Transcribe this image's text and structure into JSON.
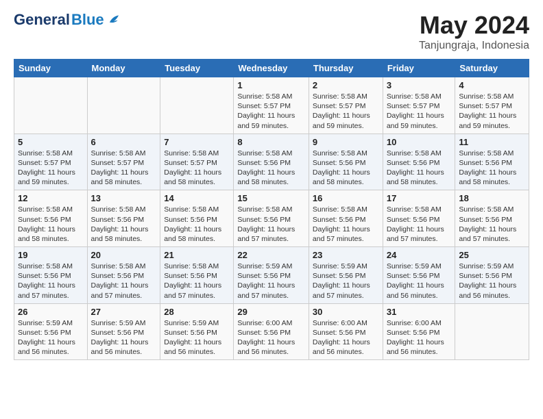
{
  "header": {
    "logo_general": "General",
    "logo_blue": "Blue",
    "month_title": "May 2024",
    "location": "Tanjungraja, Indonesia"
  },
  "weekdays": [
    "Sunday",
    "Monday",
    "Tuesday",
    "Wednesday",
    "Thursday",
    "Friday",
    "Saturday"
  ],
  "weeks": [
    [
      {
        "day": "",
        "info": ""
      },
      {
        "day": "",
        "info": ""
      },
      {
        "day": "",
        "info": ""
      },
      {
        "day": "1",
        "info": "Sunrise: 5:58 AM\nSunset: 5:57 PM\nDaylight: 11 hours\nand 59 minutes."
      },
      {
        "day": "2",
        "info": "Sunrise: 5:58 AM\nSunset: 5:57 PM\nDaylight: 11 hours\nand 59 minutes."
      },
      {
        "day": "3",
        "info": "Sunrise: 5:58 AM\nSunset: 5:57 PM\nDaylight: 11 hours\nand 59 minutes."
      },
      {
        "day": "4",
        "info": "Sunrise: 5:58 AM\nSunset: 5:57 PM\nDaylight: 11 hours\nand 59 minutes."
      }
    ],
    [
      {
        "day": "5",
        "info": "Sunrise: 5:58 AM\nSunset: 5:57 PM\nDaylight: 11 hours\nand 59 minutes."
      },
      {
        "day": "6",
        "info": "Sunrise: 5:58 AM\nSunset: 5:57 PM\nDaylight: 11 hours\nand 58 minutes."
      },
      {
        "day": "7",
        "info": "Sunrise: 5:58 AM\nSunset: 5:57 PM\nDaylight: 11 hours\nand 58 minutes."
      },
      {
        "day": "8",
        "info": "Sunrise: 5:58 AM\nSunset: 5:56 PM\nDaylight: 11 hours\nand 58 minutes."
      },
      {
        "day": "9",
        "info": "Sunrise: 5:58 AM\nSunset: 5:56 PM\nDaylight: 11 hours\nand 58 minutes."
      },
      {
        "day": "10",
        "info": "Sunrise: 5:58 AM\nSunset: 5:56 PM\nDaylight: 11 hours\nand 58 minutes."
      },
      {
        "day": "11",
        "info": "Sunrise: 5:58 AM\nSunset: 5:56 PM\nDaylight: 11 hours\nand 58 minutes."
      }
    ],
    [
      {
        "day": "12",
        "info": "Sunrise: 5:58 AM\nSunset: 5:56 PM\nDaylight: 11 hours\nand 58 minutes."
      },
      {
        "day": "13",
        "info": "Sunrise: 5:58 AM\nSunset: 5:56 PM\nDaylight: 11 hours\nand 58 minutes."
      },
      {
        "day": "14",
        "info": "Sunrise: 5:58 AM\nSunset: 5:56 PM\nDaylight: 11 hours\nand 58 minutes."
      },
      {
        "day": "15",
        "info": "Sunrise: 5:58 AM\nSunset: 5:56 PM\nDaylight: 11 hours\nand 57 minutes."
      },
      {
        "day": "16",
        "info": "Sunrise: 5:58 AM\nSunset: 5:56 PM\nDaylight: 11 hours\nand 57 minutes."
      },
      {
        "day": "17",
        "info": "Sunrise: 5:58 AM\nSunset: 5:56 PM\nDaylight: 11 hours\nand 57 minutes."
      },
      {
        "day": "18",
        "info": "Sunrise: 5:58 AM\nSunset: 5:56 PM\nDaylight: 11 hours\nand 57 minutes."
      }
    ],
    [
      {
        "day": "19",
        "info": "Sunrise: 5:58 AM\nSunset: 5:56 PM\nDaylight: 11 hours\nand 57 minutes."
      },
      {
        "day": "20",
        "info": "Sunrise: 5:58 AM\nSunset: 5:56 PM\nDaylight: 11 hours\nand 57 minutes."
      },
      {
        "day": "21",
        "info": "Sunrise: 5:58 AM\nSunset: 5:56 PM\nDaylight: 11 hours\nand 57 minutes."
      },
      {
        "day": "22",
        "info": "Sunrise: 5:59 AM\nSunset: 5:56 PM\nDaylight: 11 hours\nand 57 minutes."
      },
      {
        "day": "23",
        "info": "Sunrise: 5:59 AM\nSunset: 5:56 PM\nDaylight: 11 hours\nand 57 minutes."
      },
      {
        "day": "24",
        "info": "Sunrise: 5:59 AM\nSunset: 5:56 PM\nDaylight: 11 hours\nand 56 minutes."
      },
      {
        "day": "25",
        "info": "Sunrise: 5:59 AM\nSunset: 5:56 PM\nDaylight: 11 hours\nand 56 minutes."
      }
    ],
    [
      {
        "day": "26",
        "info": "Sunrise: 5:59 AM\nSunset: 5:56 PM\nDaylight: 11 hours\nand 56 minutes."
      },
      {
        "day": "27",
        "info": "Sunrise: 5:59 AM\nSunset: 5:56 PM\nDaylight: 11 hours\nand 56 minutes."
      },
      {
        "day": "28",
        "info": "Sunrise: 5:59 AM\nSunset: 5:56 PM\nDaylight: 11 hours\nand 56 minutes."
      },
      {
        "day": "29",
        "info": "Sunrise: 6:00 AM\nSunset: 5:56 PM\nDaylight: 11 hours\nand 56 minutes."
      },
      {
        "day": "30",
        "info": "Sunrise: 6:00 AM\nSunset: 5:56 PM\nDaylight: 11 hours\nand 56 minutes."
      },
      {
        "day": "31",
        "info": "Sunrise: 6:00 AM\nSunset: 5:56 PM\nDaylight: 11 hours\nand 56 minutes."
      },
      {
        "day": "",
        "info": ""
      }
    ]
  ]
}
